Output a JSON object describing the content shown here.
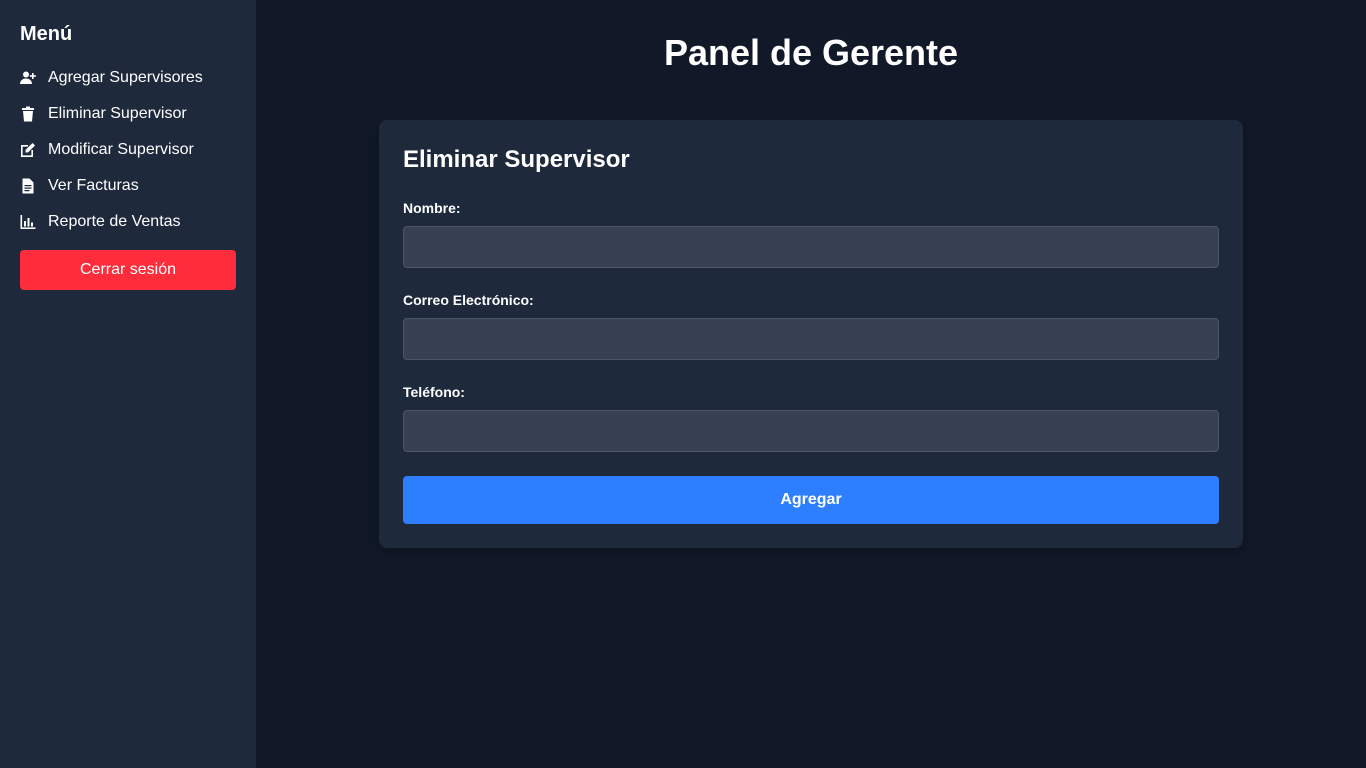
{
  "sidebar": {
    "title": "Menú",
    "items": [
      {
        "label": "Agregar Supervisores",
        "icon": "user-plus-icon"
      },
      {
        "label": "Eliminar Supervisor",
        "icon": "trash-icon"
      },
      {
        "label": "Modificar Supervisor",
        "icon": "edit-icon"
      },
      {
        "label": "Ver Facturas",
        "icon": "document-icon"
      },
      {
        "label": "Reporte de Ventas",
        "icon": "bar-chart-icon"
      }
    ],
    "logout_label": "Cerrar sesión"
  },
  "main": {
    "title": "Panel de Gerente",
    "form": {
      "title": "Eliminar Supervisor",
      "fields": [
        {
          "label": "Nombre:",
          "value": ""
        },
        {
          "label": "Correo Electrónico:",
          "value": ""
        },
        {
          "label": "Teléfono:",
          "value": ""
        }
      ],
      "submit_label": "Agregar"
    }
  },
  "colors": {
    "background": "#111827",
    "sidebar": "#1e293b",
    "card": "#1e293b",
    "input": "#374151",
    "danger": "#ff2d3b",
    "primary": "#2d7fff"
  }
}
